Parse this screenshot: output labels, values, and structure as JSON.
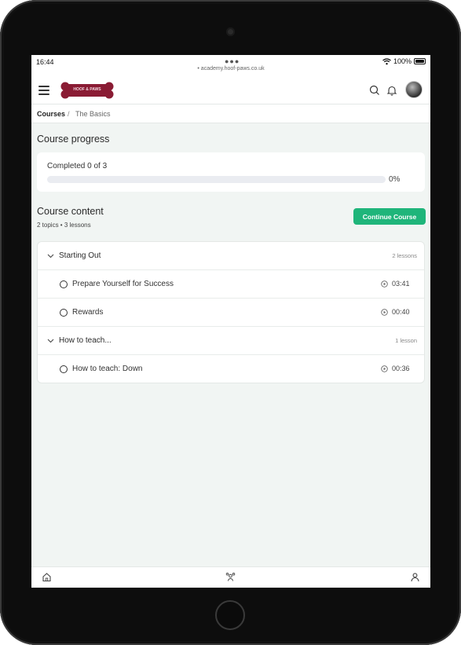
{
  "statusbar": {
    "time": "16:44",
    "url": "academy.hoof-paws.co.uk",
    "battery": "100%"
  },
  "topbar": {
    "logo_text": "HOOF & PAWS",
    "icons": [
      "menu-icon",
      "search-icon",
      "bell-icon",
      "avatar"
    ]
  },
  "breadcrumb": {
    "root": "Courses",
    "separator": "/",
    "current": "The Basics"
  },
  "progress": {
    "title": "Course progress",
    "label": "Completed 0 of 3",
    "percent_text": "0%",
    "percent": 0
  },
  "content": {
    "title": "Course content",
    "meta": "2 topics • 3 lessons",
    "continue_label": "Continue Course",
    "topics": [
      {
        "title": "Starting Out",
        "count": "2 lessons",
        "lessons": [
          {
            "title": "Prepare Yourself for Success",
            "duration": "03:41"
          },
          {
            "title": "Rewards",
            "duration": "00:40"
          }
        ]
      },
      {
        "title": "How to teach...",
        "count": "1 lesson",
        "lessons": [
          {
            "title": "How to teach: Down",
            "duration": "00:36"
          }
        ]
      }
    ]
  },
  "bottombar": {
    "icons": [
      "home-icon",
      "community-icon",
      "profile-icon"
    ]
  },
  "colors": {
    "accent": "#1fb57a",
    "logo": "#8a1c34",
    "page_bg": "#f1f5f3"
  }
}
